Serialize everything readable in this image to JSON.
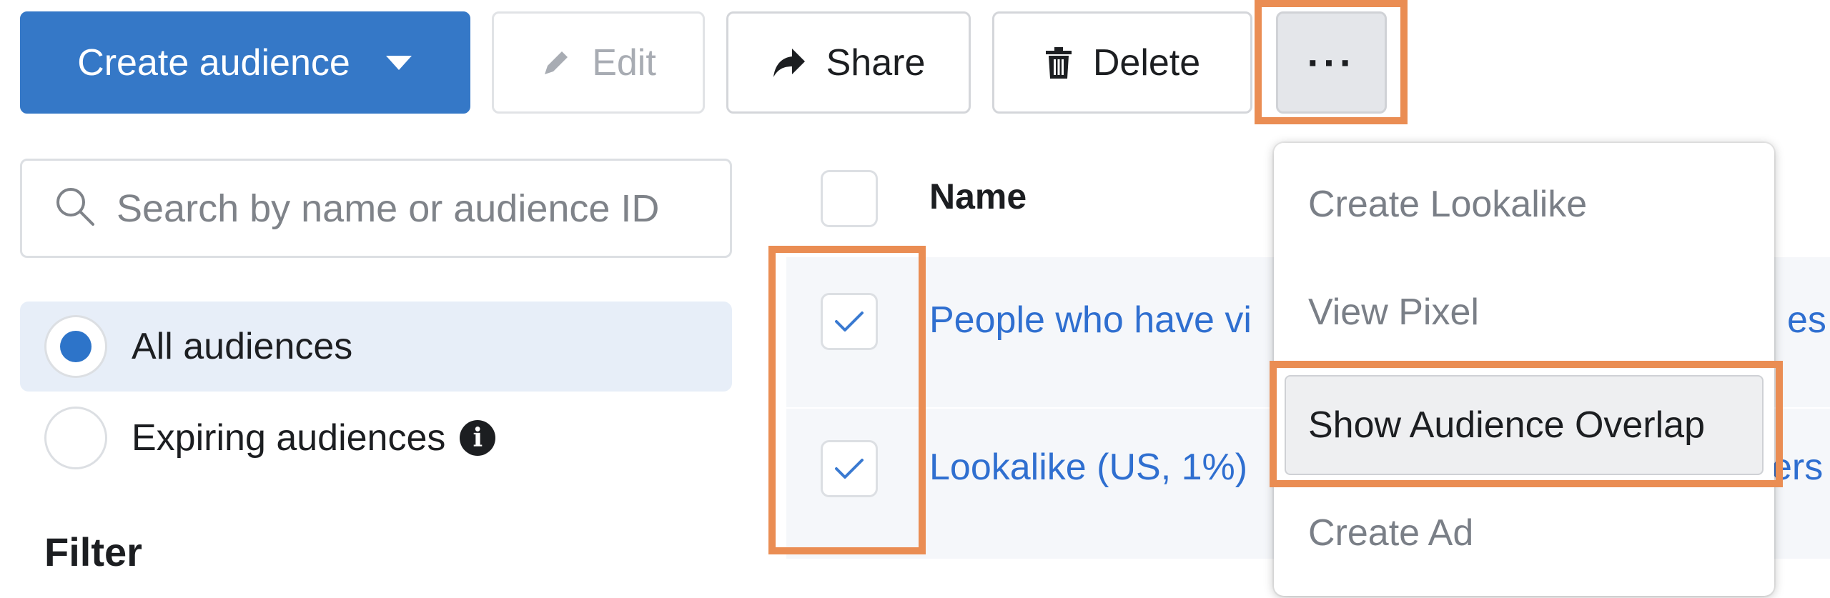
{
  "toolbar": {
    "create_label": "Create audience",
    "edit_label": "Edit",
    "share_label": "Share",
    "delete_label": "Delete",
    "more_label": "···"
  },
  "search": {
    "placeholder": "Search by name or audience ID",
    "value": ""
  },
  "audience_filters": [
    {
      "label": "All audiences",
      "selected": true
    },
    {
      "label": "Expiring audiences",
      "selected": false,
      "icon": "info-icon"
    }
  ],
  "filter_section": {
    "title": "Filter"
  },
  "table": {
    "columns": [
      "Name"
    ],
    "rows": [
      {
        "name": "People who have vi",
        "trailing": "es",
        "checked": true
      },
      {
        "name": "Lookalike (US, 1%)",
        "trailing": "ers",
        "checked": true
      }
    ]
  },
  "more_menu": {
    "items": [
      {
        "label": "Create Lookalike",
        "enabled": false
      },
      {
        "label": "View Pixel",
        "enabled": false
      },
      {
        "label": "Show Audience Overlap",
        "enabled": true,
        "highlighted": true
      },
      {
        "label": "Create Ad",
        "enabled": false
      }
    ]
  },
  "colors": {
    "primary": "#3578c7",
    "highlight": "#ea8d53",
    "link": "#2f6fd0",
    "selected_row": "#e7eef8"
  }
}
